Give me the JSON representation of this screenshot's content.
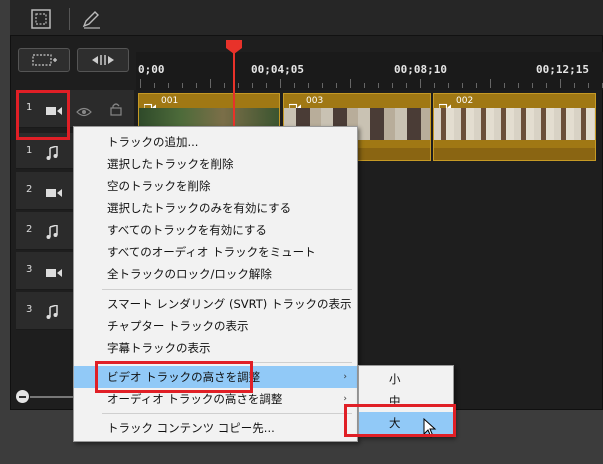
{
  "ruler": {
    "labels": [
      "0;00",
      "00;04;05",
      "00;08;10",
      "00;12;15"
    ]
  },
  "tracks": [
    {
      "num": "1",
      "icon": "video-camera-icon"
    },
    {
      "num": "1",
      "icon": "music-note-icon"
    },
    {
      "num": "2",
      "icon": "video-camera-icon"
    },
    {
      "num": "2",
      "icon": "music-note-icon"
    },
    {
      "num": "3",
      "icon": "video-camera-icon"
    },
    {
      "num": "3",
      "icon": "music-note-icon"
    }
  ],
  "clips": [
    {
      "label": "001"
    },
    {
      "label": "003"
    },
    {
      "label": "002"
    }
  ],
  "menu": {
    "items": [
      "トラックの追加...",
      "選択したトラックを削除",
      "空のトラックを削除",
      "選択したトラックのみを有効にする",
      "すべてのトラックを有効にする",
      "すべてのオーディオ トラックをミュート",
      "全トラックのロック/ロック解除",
      "スマート レンダリング (SVRT) トラックの表示",
      "チャプター トラックの表示",
      "字幕トラックの表示",
      "ビデオ トラックの高さを調整",
      "オーディオ トラックの高さを調整",
      "トラック コンテンツ コピー先..."
    ],
    "arrow": "›"
  },
  "submenu": {
    "items": [
      "小",
      "中",
      "大"
    ]
  },
  "colors": {
    "accent_red": "#e01f26",
    "highlight": "#91c9f7",
    "clip": "#a07814"
  }
}
